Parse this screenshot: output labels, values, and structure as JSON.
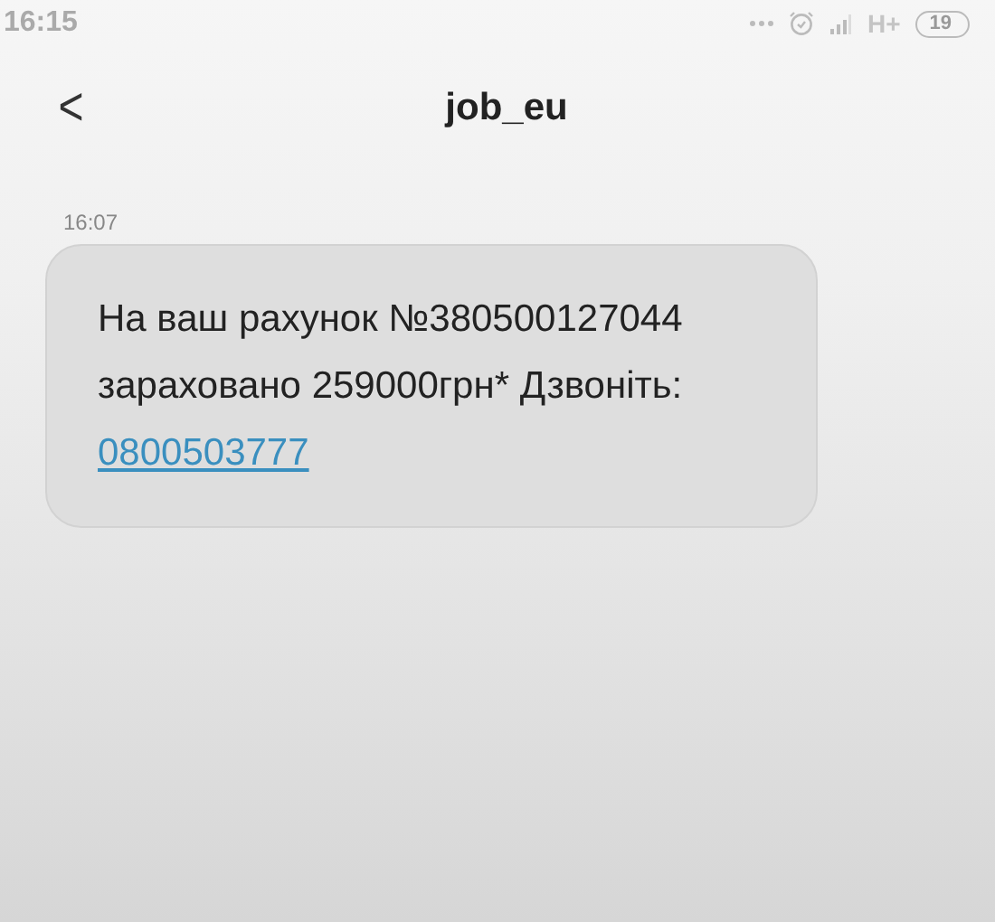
{
  "status_bar": {
    "time": "16:15",
    "network": "H+",
    "battery": "19"
  },
  "header": {
    "back": "<",
    "title": "job_eu"
  },
  "messages": [
    {
      "time": "16:07",
      "text": "На ваш рахунок №380500127044 зараховано 259000грн* Дзвоніть: ",
      "link": "0800503777"
    }
  ]
}
